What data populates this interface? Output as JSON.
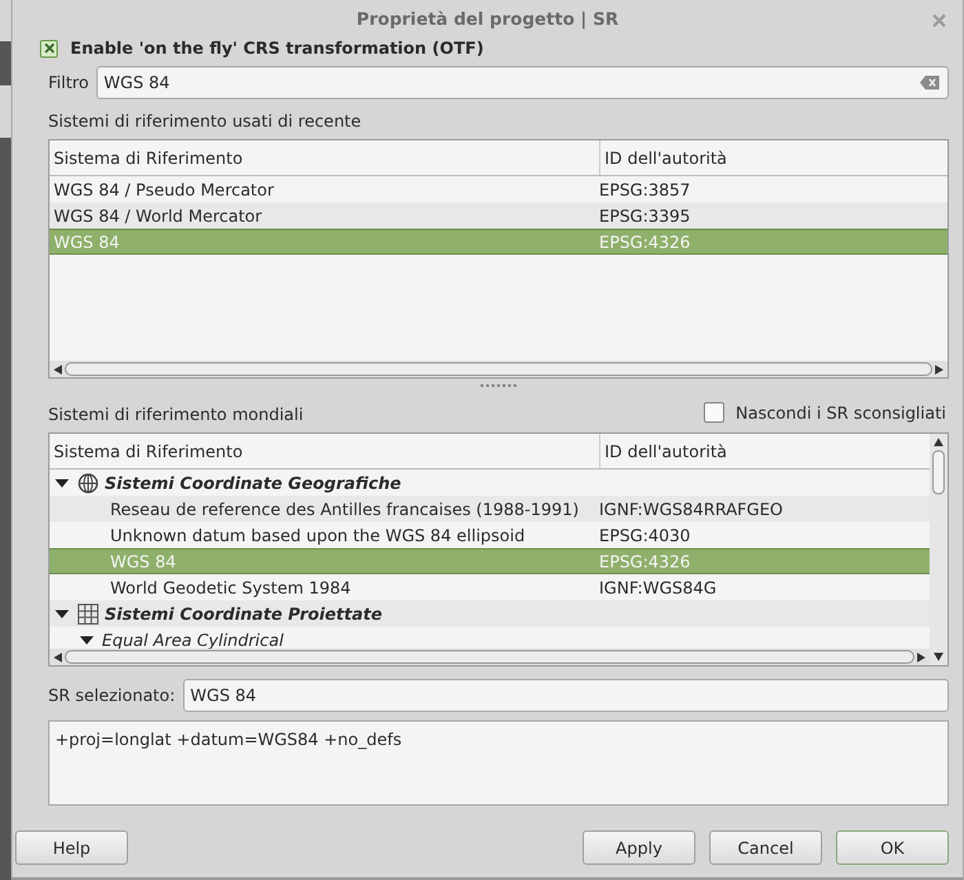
{
  "window": {
    "title": "Proprietà del progetto | SR"
  },
  "otf": {
    "label": "Enable 'on the fly' CRS transformation (OTF)",
    "checked": true
  },
  "filter": {
    "label": "Filtro",
    "value": "WGS 84"
  },
  "recent": {
    "title": "Sistemi di riferimento usati di recente",
    "columns": [
      "Sistema di Riferimento",
      "ID dell'autorità"
    ],
    "rows": [
      {
        "name": "WGS 84 / Pseudo Mercator",
        "authority": "EPSG:3857",
        "selected": false
      },
      {
        "name": "WGS 84 / World Mercator",
        "authority": "EPSG:3395",
        "selected": false
      },
      {
        "name": "WGS 84",
        "authority": "EPSG:4326",
        "selected": true
      }
    ]
  },
  "world": {
    "title": "Sistemi di riferimento mondiali",
    "hide_deprecated": {
      "label": "Nascondi i SR sconsigliati",
      "checked": false
    },
    "columns": [
      "Sistema di Riferimento",
      "ID dell'autorità"
    ],
    "tree": [
      {
        "kind": "globe",
        "name": "Sistemi Coordinate Geografiche",
        "expanded": true,
        "children": [
          {
            "name": "Reseau de reference des Antilles francaises (1988-1991)",
            "authority": "IGNF:WGS84RRAFGEO",
            "selected": false
          },
          {
            "name": "Unknown datum based upon the WGS 84 ellipsoid",
            "authority": "EPSG:4030",
            "selected": false
          },
          {
            "name": "WGS 84",
            "authority": "EPSG:4326",
            "selected": true
          },
          {
            "name": "World Geodetic System 1984",
            "authority": "IGNF:WGS84G",
            "selected": false
          }
        ]
      },
      {
        "kind": "grid",
        "name": "Sistemi Coordinate Proiettate",
        "expanded": true,
        "children": [
          {
            "kind": "folder",
            "name": "Equal Area Cylindrical",
            "expanded": true
          }
        ]
      }
    ]
  },
  "selected_crs": {
    "label": "SR selezionato:",
    "value": "WGS 84"
  },
  "proj_string": "+proj=longlat +datum=WGS84 +no_defs",
  "buttons": [
    {
      "label": "Help",
      "kind": "left"
    },
    {
      "label": "Apply",
      "kind": "right"
    },
    {
      "label": "Cancel",
      "kind": "right"
    },
    {
      "label": "OK",
      "kind": "default"
    }
  ]
}
